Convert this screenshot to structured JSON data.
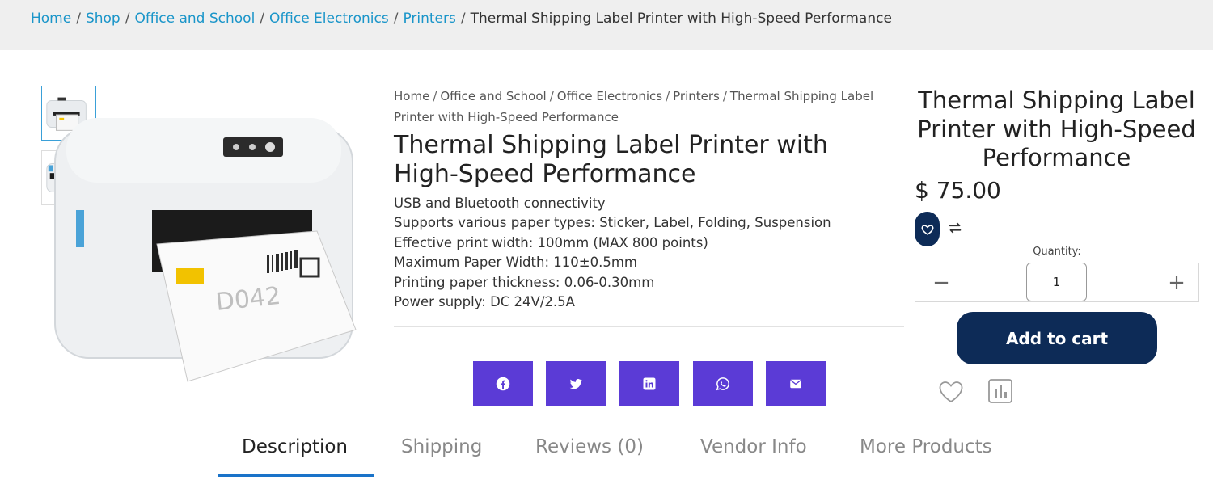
{
  "breadcrumb_top": [
    "Home",
    "Shop",
    "Office and School",
    "Office Electronics",
    "Printers"
  ],
  "breadcrumb_top_current": "Thermal Shipping Label Printer with High-Speed Performance",
  "breadcrumb_mid": [
    "Home",
    "Office and School",
    "Office Electronics",
    "Printers"
  ],
  "breadcrumb_mid_current": "Thermal Shipping Label Printer with High-Speed Performance",
  "breadcrumb_separator": "/",
  "product": {
    "title": "Thermal Shipping Label Printer with High-Speed Performance",
    "price": "$ 75.00",
    "features": [
      "USB and Bluetooth connectivity",
      "Supports various paper types: Sticker, Label, Folding, Suspension",
      "Effective print width: 100mm (MAX 800 points)",
      "Maximum Paper Width: 110±0.5mm",
      "Printing paper thickness: 0.06-0.30mm",
      "Power supply: DC 24V/2.5A"
    ],
    "image_label_text": "D042"
  },
  "share_buttons": [
    "facebook-icon",
    "twitter-icon",
    "linkedin-icon",
    "whatsapp-icon",
    "email-icon"
  ],
  "purchase": {
    "quantity_label": "Quantity:",
    "quantity_value": "1",
    "minus": "−",
    "plus": "+",
    "add_to_cart": "Add to cart"
  },
  "tabs": [
    "Description",
    "Shipping",
    "Reviews (0)",
    "Vendor Info",
    "More Products"
  ],
  "active_tab": "Description",
  "colors": {
    "link": "#1a95c9",
    "share_bg": "#5b3bd6",
    "primary_navy": "#0d2b57",
    "tab_underline": "#1a73c9",
    "topbar_bg": "#efefef"
  }
}
